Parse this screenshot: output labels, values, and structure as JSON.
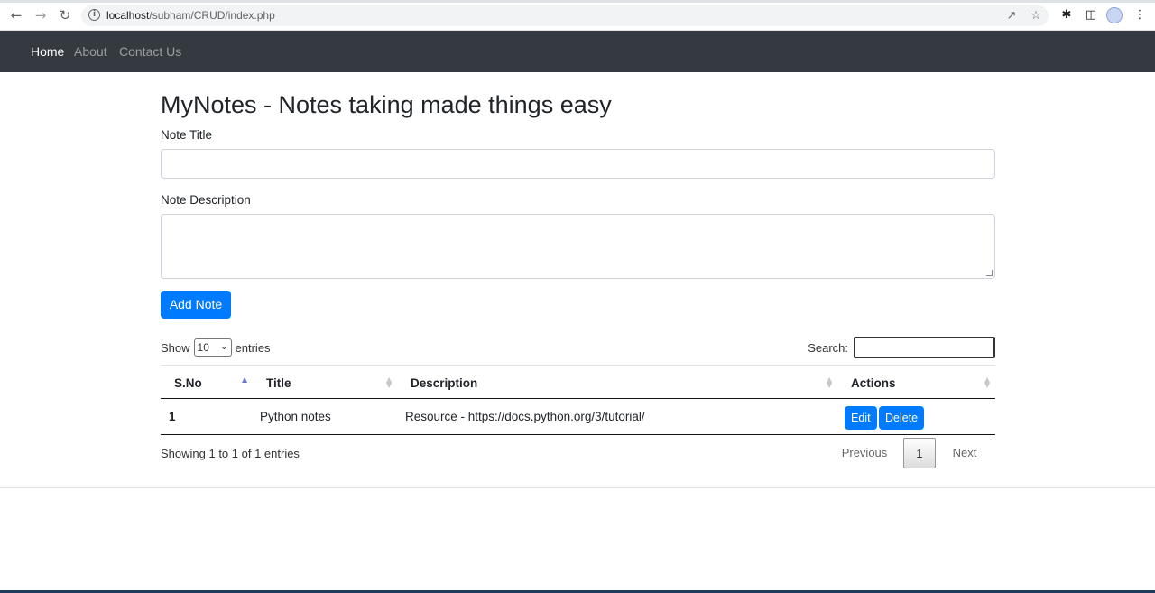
{
  "browser": {
    "url_host": "localhost",
    "url_path": "/subham/CRUD/index.php"
  },
  "navbar": {
    "items": [
      {
        "label": "Home",
        "active": true
      },
      {
        "label": "About",
        "active": false
      },
      {
        "label": "Contact Us",
        "active": false
      }
    ]
  },
  "main": {
    "heading": "MyNotes - Notes taking made things easy",
    "title_label": "Note Title",
    "title_value": "",
    "description_label": "Note Description",
    "description_value": "",
    "add_button": "Add Note"
  },
  "datatable": {
    "show_label": "Show",
    "entries_label": "entries",
    "page_length": "10",
    "search_label": "Search:",
    "search_value": "",
    "columns": [
      "S.No",
      "Title",
      "Description",
      "Actions"
    ],
    "rows": [
      {
        "sno": "1",
        "title": "Python notes",
        "description": "Resource - https://docs.python.org/3/tutorial/",
        "edit_label": "Edit",
        "delete_label": "Delete"
      }
    ],
    "info": "Showing 1 to 1 of 1 entries",
    "pagination": {
      "previous": "Previous",
      "current": "1",
      "next": "Next"
    }
  },
  "colors": {
    "navbar_bg": "#343a40",
    "primary": "#007bff"
  }
}
